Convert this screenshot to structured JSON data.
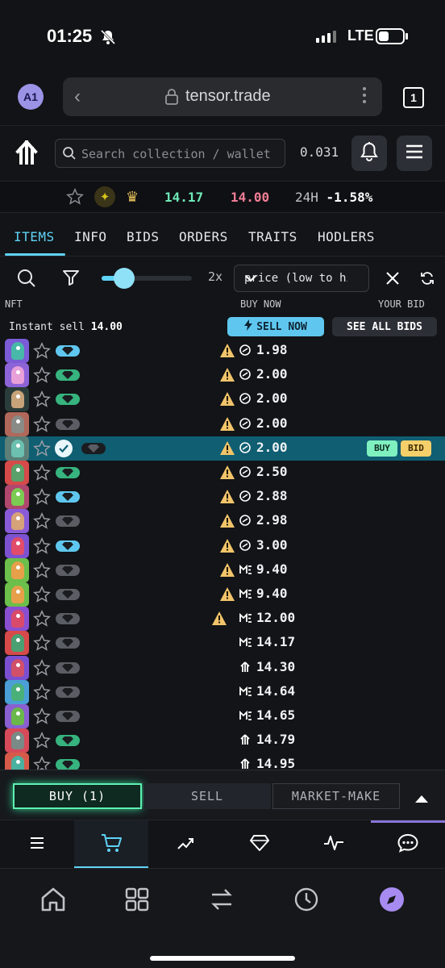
{
  "status_bar": {
    "time": "01:25",
    "network": "LTE"
  },
  "browser": {
    "account_badge": "A1",
    "host": "tensor.trade",
    "tab_count": "1"
  },
  "topnav": {
    "search_placeholder": "Search collection / wallet",
    "balance": "0.031"
  },
  "stats": {
    "floor": "14.17",
    "best_bid": "14.00",
    "change_label": "24H",
    "change_value": "-1.58%"
  },
  "tabs": [
    "ITEMS",
    "INFO",
    "BIDS",
    "ORDERS",
    "TRAITS",
    "HODLERS"
  ],
  "filters": {
    "zoom": "2x",
    "sort_value": "price (low to high)",
    "slider_level": 0.25
  },
  "columns": {
    "nft": "NFT",
    "buy_now": "BUY NOW",
    "your_bid": "YOUR BID"
  },
  "instant_sell": {
    "label": "Instant sell",
    "value": "14.00",
    "sell_now": "SELL NOW",
    "see_all_bids": "SEE ALL BIDS"
  },
  "row_actions": {
    "buy": "BUY",
    "bid": "BID"
  },
  "items": [
    {
      "price": "1.98",
      "bg": "#7b5bd6",
      "skin": "#48b8a8",
      "gem": "#5fc7ef",
      "warn": true,
      "market": "tensor-logo",
      "selected": false
    },
    {
      "price": "2.00",
      "bg": "#8d63d8",
      "skin": "#e8a0d8",
      "gem": "#36b37e",
      "warn": true,
      "market": "tensor-logo",
      "selected": false
    },
    {
      "price": "2.00",
      "bg": "#2b3d3a",
      "skin": "#c7a37a",
      "gem": "#36b37e",
      "warn": true,
      "market": "tensor-logo",
      "selected": false
    },
    {
      "price": "2.00",
      "bg": "#b0685a",
      "skin": "#8a8a86",
      "gem": "#5a5d63",
      "warn": true,
      "market": "tensor-logo",
      "selected": false
    },
    {
      "price": "2.00",
      "bg": "#5c7f78",
      "skin": "#6bc0b0",
      "gem": "#1a1c20",
      "warn": true,
      "market": "tensor-logo",
      "selected": true
    },
    {
      "price": "2.50",
      "bg": "#d64a4a",
      "skin": "#5aa06a",
      "gem": "#36b37e",
      "warn": true,
      "market": "tensor-logo",
      "selected": false
    },
    {
      "price": "2.88",
      "bg": "#b0476d",
      "skin": "#7bcb52",
      "gem": "#5fc7ef",
      "warn": true,
      "market": "tensor-logo",
      "selected": false
    },
    {
      "price": "2.98",
      "bg": "#8a5bd8",
      "skin": "#d6a27a",
      "gem": "#5a5d63",
      "warn": true,
      "market": "tensor-logo",
      "selected": false
    },
    {
      "price": "3.00",
      "bg": "#7d52d1",
      "skin": "#e04c6a",
      "gem": "#5fc7ef",
      "warn": true,
      "market": "tensor-logo",
      "selected": false
    },
    {
      "price": "9.40",
      "bg": "#6bbf4a",
      "skin": "#e6a04a",
      "gem": "#5a5d63",
      "warn": true,
      "market": "magic-eden-logo",
      "selected": false
    },
    {
      "price": "9.40",
      "bg": "#6bbf4a",
      "skin": "#e6a04a",
      "gem": "#5a5d63",
      "warn": true,
      "market": "magic-eden-logo",
      "selected": false
    },
    {
      "price": "12.00",
      "bg": "#8a4fd0",
      "skin": "#d94a6a",
      "gem": "#5a5d63",
      "warn": true,
      "market": "magic-eden-logo",
      "selected": false
    },
    {
      "price": "14.17",
      "bg": "#d64a4a",
      "skin": "#4aa072",
      "gem": "#5a5d63",
      "warn": false,
      "market": "magic-eden-logo",
      "selected": false
    },
    {
      "price": "14.30",
      "bg": "#7a4fd0",
      "skin": "#d0506a",
      "gem": "#5a5d63",
      "warn": false,
      "market": "tensor-logo",
      "selected": false
    },
    {
      "price": "14.64",
      "bg": "#4a9fd6",
      "skin": "#4ab07a",
      "gem": "#5a5d63",
      "warn": false,
      "market": "magic-eden-logo",
      "selected": false
    },
    {
      "price": "14.65",
      "bg": "#8a5fd0",
      "skin": "#6ab84a",
      "gem": "#5a5d63",
      "warn": false,
      "market": "magic-eden-logo",
      "selected": false
    },
    {
      "price": "14.79",
      "bg": "#d64a5a",
      "skin": "#7a8a86",
      "gem": "#36b37e",
      "warn": false,
      "market": "tensor-logo",
      "selected": false
    },
    {
      "price": "14.95",
      "bg": "#d65a4a",
      "skin": "#4ab0a0",
      "gem": "#36b37e",
      "warn": false,
      "market": "tensor-logo",
      "selected": false
    }
  ],
  "trade_tabs": {
    "buy": "BUY (1)",
    "sell": "SELL",
    "market_make": "MARKET-MAKE"
  },
  "bottom_tabs": [
    "menu-icon",
    "cart-icon",
    "chart-icon",
    "diamond-icon",
    "activity-icon",
    "chat-icon"
  ],
  "safari_toolbar": [
    "home-icon",
    "grid-icon",
    "swap-icon",
    "history-icon",
    "compass-icon"
  ],
  "colors": {
    "accent": "#5fd3f5",
    "buy": "#7ff0c0",
    "bid": "#f5cf6a",
    "up": "#6ee9b8",
    "down": "#f07d96"
  }
}
